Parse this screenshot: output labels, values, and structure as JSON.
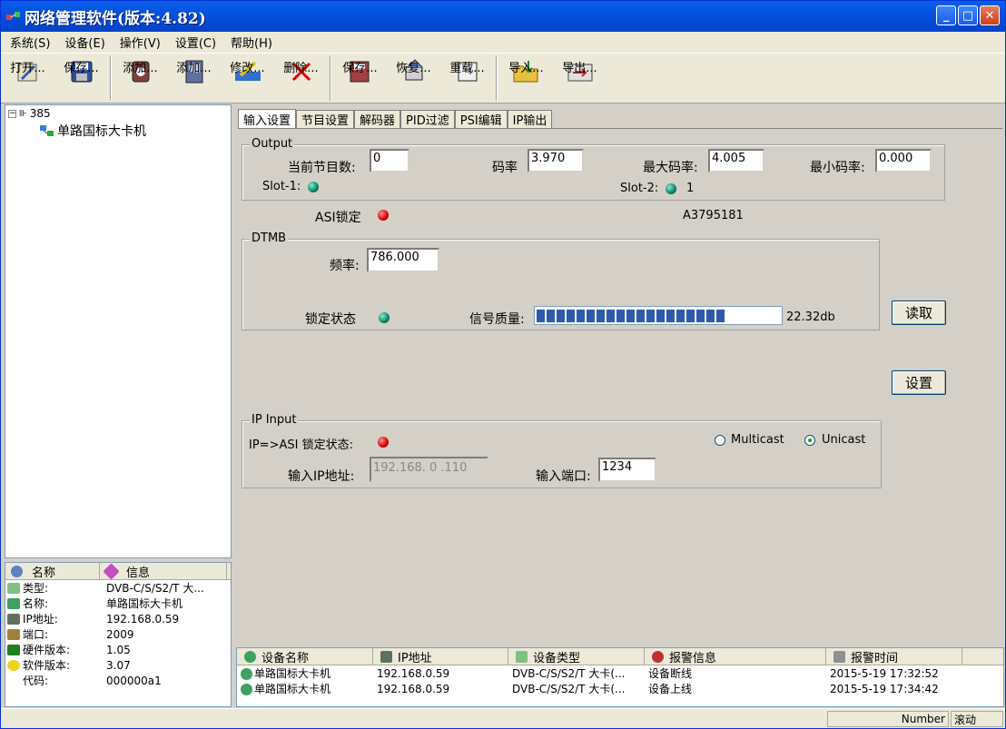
{
  "window": {
    "title": "网络管理软件(版本:4.82)"
  },
  "menu": [
    "系统(S)",
    "设备(E)",
    "操作(V)",
    "设置(C)",
    "帮助(H)"
  ],
  "toolbar": {
    "open": "打开...",
    "save1": "保存...",
    "add1": "添加...",
    "add2": "添加...",
    "modify": "修改...",
    "delete": "删除...",
    "save2": "保存...",
    "restore": "恢复...",
    "reload": "重载...",
    "import": "导入...",
    "export": "导出..."
  },
  "tree": {
    "root": "385",
    "child": "单路国标大卡机"
  },
  "props": {
    "col_name": "名称",
    "col_info": "信息",
    "rows": [
      {
        "k": "类型:",
        "v": "DVB-C/S/S2/T 大..."
      },
      {
        "k": "名称:",
        "v": "单路国标大卡机"
      },
      {
        "k": "IP地址:",
        "v": "192.168.0.59"
      },
      {
        "k": "端口:",
        "v": "2009"
      },
      {
        "k": "硬件版本:",
        "v": "1.05"
      },
      {
        "k": "软件版本:",
        "v": "3.07"
      },
      {
        "k": "代码:",
        "v": "000000a1"
      }
    ]
  },
  "tabs": [
    "输入设置",
    "节目设置",
    "解码器",
    "PID过滤",
    "PSI编辑",
    "IP输出"
  ],
  "output": {
    "group": "Output",
    "program_count_label": "当前节目数:",
    "program_count": "0",
    "bitrate_label": "码率",
    "bitrate": "3.970",
    "max_bitrate_label": "最大码率:",
    "max_bitrate": "4.005",
    "min_bitrate_label": "最小码率:",
    "min_bitrate": "0.000",
    "slot1_label": "Slot-1:",
    "slot2_label": "Slot-2:",
    "slot2_value": "1"
  },
  "asi": {
    "label": "ASI锁定",
    "code": "A3795181"
  },
  "dtmb": {
    "group": "DTMB",
    "freq_label": "频率:",
    "freq": "786.000",
    "lock_label": "锁定状态",
    "quality_label": "信号质量:",
    "quality_value": "22.32db",
    "quality_fraction": 0.8
  },
  "buttons": {
    "read": "读取",
    "set": "设置"
  },
  "ip_input": {
    "group": "IP Input",
    "lock_label": "IP=>ASI 锁定状态:",
    "multicast": "Multicast",
    "unicast": "Unicast",
    "ip_label": "输入IP地址:",
    "ip": "192.168. 0 .110",
    "port_label": "输入端口:",
    "port": "1234"
  },
  "alarms": {
    "headers": [
      "设备名称",
      "IP地址",
      "设备类型",
      "报警信息",
      "报警时间"
    ],
    "rows": [
      [
        "单路国标大卡机",
        "192.168.0.59",
        "DVB-C/S/S2/T 大卡(...",
        "设备断线",
        "2015-5-19 17:32:52"
      ],
      [
        "单路国标大卡机",
        "192.168.0.59",
        "DVB-C/S/S2/T 大卡(...",
        "设备上线",
        "2015-5-19 17:34:42"
      ]
    ]
  },
  "status": {
    "number": "Number",
    "scroll": "滚动"
  },
  "colors": {
    "title_bar": "#0551e0",
    "led_green": "#0a8060",
    "led_red": "#d00000",
    "quality_bar": "#2d5aae"
  }
}
